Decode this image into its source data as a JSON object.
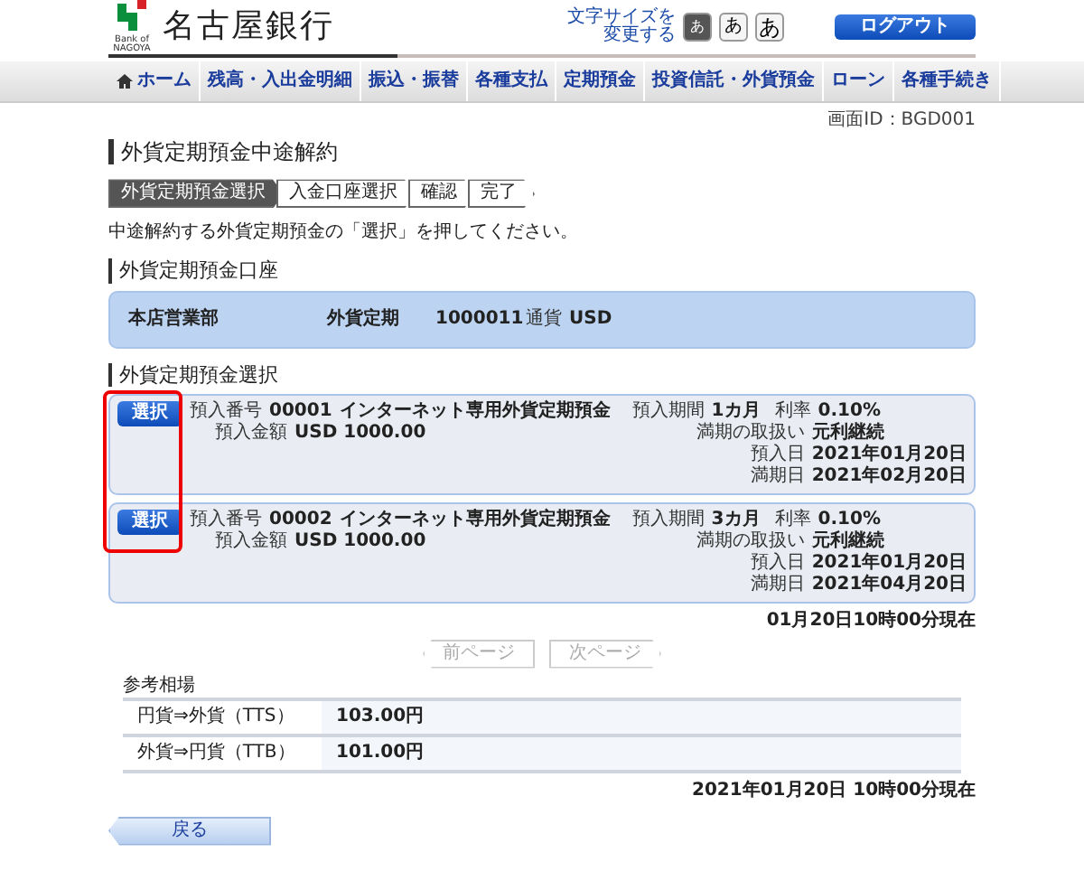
{
  "header": {
    "bank_name": "名古屋銀行",
    "logo_subtext": "Bank of NAGOYA",
    "font_size_label": [
      "文字サイズを",
      "変更する"
    ],
    "font_sizes": [
      {
        "label": "あ",
        "selected": true
      },
      {
        "label": "あ",
        "selected": false
      },
      {
        "label": "あ",
        "selected": false
      }
    ],
    "logout": "ログアウト"
  },
  "nav": [
    {
      "label": "ホーム",
      "kind": "home"
    },
    {
      "label": "残高・入出金明細",
      "kind": "link"
    },
    {
      "label": "振込・振替",
      "kind": "link"
    },
    {
      "label": "各種支払",
      "kind": "link"
    },
    {
      "label": "定期預金",
      "kind": "link"
    },
    {
      "label": "投資信託・外貨預金",
      "kind": "link"
    },
    {
      "label": "ローン",
      "kind": "link"
    },
    {
      "label": "各種手続き",
      "kind": "link"
    }
  ],
  "screen_id": "画面ID：BGD001",
  "title": "外貨定期預金中途解約",
  "steps": [
    {
      "label": "外貨定期預金選択",
      "selected": true
    },
    {
      "label": "入金口座選択",
      "selected": false
    },
    {
      "label": "確認",
      "selected": false
    },
    {
      "label": "完了",
      "selected": false
    }
  ],
  "instruction": "中途解約する外貨定期預金の「選択」を押してください。",
  "account_section": {
    "heading": "外貨定期預金口座",
    "branch": "本店営業部",
    "type": "外貨定期",
    "number": "1000011",
    "currency_label": "通貨",
    "currency": "USD"
  },
  "deposit_section": {
    "heading": "外貨定期預金選択",
    "deposits": [
      {
        "button": "選択",
        "number_label": "預入番号",
        "number": "00001",
        "product": "インターネット専用外貨定期預金",
        "term_label": "預入期間",
        "term": "1カ月",
        "rate_label": "利率",
        "rate": "0.10%",
        "amount_label": "預入金額",
        "amount": "USD 1000.00",
        "details": [
          {
            "label": "満期の取扱い",
            "value": "元利継続"
          },
          {
            "label": "預入日",
            "value": "2021年01月20日"
          },
          {
            "label": "満期日",
            "value": "2021年02月20日"
          }
        ]
      },
      {
        "button": "選択",
        "number_label": "預入番号",
        "number": "00002",
        "product": "インターネット専用外貨定期預金",
        "term_label": "預入期間",
        "term": "3カ月",
        "rate_label": "利率",
        "rate": "0.10%",
        "amount_label": "預入金額",
        "amount": "USD 1000.00",
        "details": [
          {
            "label": "満期の取扱い",
            "value": "元利継続"
          },
          {
            "label": "預入日",
            "value": "2021年01月20日"
          },
          {
            "label": "満期日",
            "value": "2021年04月20日"
          }
        ]
      }
    ],
    "as_of": "01月20日10時00分現在"
  },
  "pager": [
    {
      "label": "前ページ",
      "kind": "prev",
      "disabled": true
    },
    {
      "label": "次ページ",
      "kind": "next",
      "disabled": true
    }
  ],
  "rates": {
    "title": "参考相場",
    "rows": [
      {
        "label": "円貨⇒外貨（TTS）",
        "value": "103.00円"
      },
      {
        "label": "外貨⇒円貨（TTB）",
        "value": "101.00円"
      }
    ],
    "as_of": "2021年01月20日 10時00分現在"
  },
  "back_button": "戻る"
}
